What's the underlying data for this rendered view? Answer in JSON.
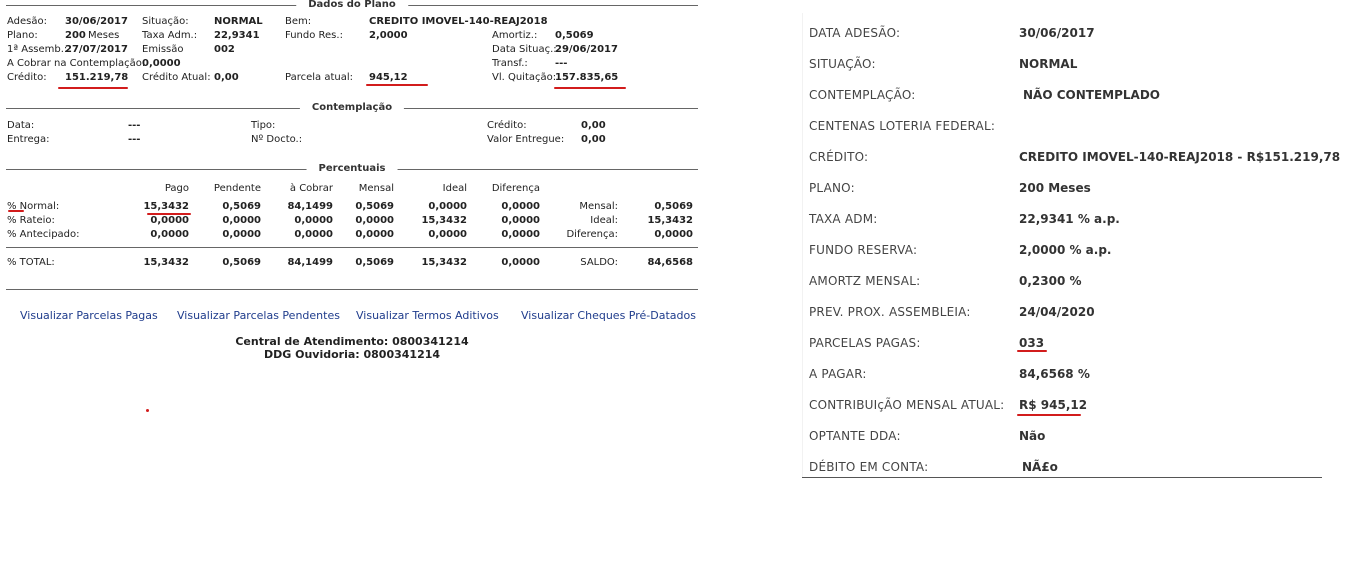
{
  "dados_plano": {
    "title": "Dados do Plano",
    "adesao_label": "Adesão:",
    "adesao_value": "30/06/2017",
    "plano_label": "Plano:",
    "plano_value": "200",
    "plano_unit": "Meses",
    "assemb_label": "1ª Assemb.:",
    "assemb_value": "27/07/2017",
    "a_cobrar_label": "A Cobrar na Contemplação:",
    "a_cobrar_value": "0,0000",
    "credito_label": "Crédito:",
    "credito_value": "151.219,78",
    "situacao_label": "Situação:",
    "situacao_value": "NORMAL",
    "taxa_label": "Taxa Adm.:",
    "taxa_value": "22,9341",
    "emissao_label": "Emissão",
    "emissao_value": "002",
    "credito_atual_label": "Crédito Atual:",
    "credito_atual_value": "0,00",
    "bem_label": "Bem:",
    "bem_value": "CREDITO IMOVEL-140-REAJ2018",
    "fundo_label": "Fundo Res.:",
    "fundo_value": "2,0000",
    "parcela_label": "Parcela atual:",
    "parcela_value": "945,12",
    "amortiz_label": "Amortiz.:",
    "amortiz_value": "0,5069",
    "data_situac_label": "Data Situaç.:",
    "data_situac_value": "29/06/2017",
    "transf_label": "Transf.:",
    "transf_value": "---",
    "quitacao_label": "Vl. Quitação:",
    "quitacao_value": "157.835,65"
  },
  "contemplacao": {
    "title": "Contemplação",
    "data_label": "Data:",
    "data_value": "---",
    "entrega_label": "Entrega:",
    "entrega_value": "---",
    "tipo_label": "Tipo:",
    "docto_label": "Nº Docto.:",
    "credito_label": "Crédito:",
    "credito_value": "0,00",
    "valor_entregue_label": "Valor Entregue:",
    "valor_entregue_value": "0,00"
  },
  "percentuais": {
    "title": "Percentuais",
    "headers": [
      "Pago",
      "Pendente",
      "à Cobrar",
      "Mensal",
      "Ideal",
      "Diferença"
    ],
    "rows": [
      {
        "label": "% Normal:",
        "values": [
          "15,3432",
          "0,5069",
          "84,1499",
          "0,5069",
          "0,0000",
          "0,0000"
        ],
        "side_label": "Mensal:",
        "side_value": "0,5069"
      },
      {
        "label": "% Rateio:",
        "values": [
          "0,0000",
          "0,0000",
          "0,0000",
          "0,0000",
          "15,3432",
          "0,0000"
        ],
        "side_label": "Ideal:",
        "side_value": "15,3432"
      },
      {
        "label": "% Antecipado:",
        "values": [
          "0,0000",
          "0,0000",
          "0,0000",
          "0,0000",
          "0,0000",
          "0,0000"
        ],
        "side_label": "Diferença:",
        "side_value": "0,0000"
      }
    ],
    "total": {
      "label": "% TOTAL:",
      "values": [
        "15,3432",
        "0,5069",
        "84,1499",
        "0,5069",
        "15,3432",
        "0,0000"
      ],
      "side_label": "SALDO:",
      "side_value": "84,6568"
    }
  },
  "links": {
    "parcelas_pagas": "Visualizar Parcelas Pagas",
    "parcelas_pendentes": "Visualizar Parcelas Pendentes",
    "termos_aditivos": "Visualizar Termos Aditivos",
    "cheques": "Visualizar Cheques Pré-Datados"
  },
  "contact": {
    "atendimento": "Central de Atendimento: 0800341214",
    "ouvidoria": "DDG Ouvidoria: 0800341214"
  },
  "summary": {
    "rows": [
      {
        "label": "DATA ADESÃO:",
        "value": "30/06/2017"
      },
      {
        "label": "SITUAÇÃO:",
        "value": "NORMAL"
      },
      {
        "label": "CONTEMPLAÇÃO:",
        "value": "NÃO CONTEMPLADO"
      },
      {
        "label": "CENTENAS LOTERIA FEDERAL:",
        "value": ""
      },
      {
        "label": "CRÉDITO:",
        "value": "CREDITO IMOVEL-140-REAJ2018 - R$151.219,78"
      },
      {
        "label": "PLANO:",
        "value": "200 Meses"
      },
      {
        "label": "TAXA ADM:",
        "value": "22,9341 % a.p."
      },
      {
        "label": "FUNDO RESERVA:",
        "value": "2,0000 % a.p."
      },
      {
        "label": "AMORTZ MENSAL:",
        "value": "0,2300 %"
      },
      {
        "label": "PREV. PROX. ASSEMBLEIA:",
        "value": "24/04/2020"
      },
      {
        "label": "PARCELAS PAGAS:",
        "value": "033"
      },
      {
        "label": "A PAGAR:",
        "value": "84,6568 %"
      },
      {
        "label": "CONTRIBUIçÃO MENSAL ATUAL:",
        "value": "R$ 945,12"
      },
      {
        "label": "OPTANTE DDA:",
        "value": "Não"
      },
      {
        "label": "DÉBITO EM CONTA:",
        "value": "NÃ£o"
      }
    ]
  },
  "colors": {
    "link": "#1f3c8c",
    "annotation": "#d21c1c",
    "rule": "#666666"
  }
}
